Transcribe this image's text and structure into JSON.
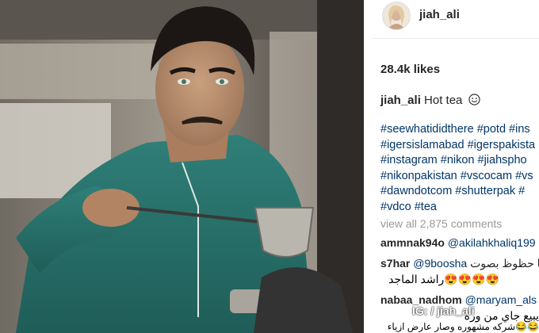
{
  "post": {
    "username": "jiah_ali",
    "likes": "28.4k likes",
    "caption_user": "jiah_ali",
    "caption_text": "Hot tea",
    "caption_emoji": "smiling-face-icon",
    "hashtag_lines": [
      "#seewhatididthere #potd #ins",
      "#igersislamabad #igerspakista",
      "#instagram #nikon #jiahspho",
      "#nikonpakistan #vscocam #vs",
      "#dawndotcom #shutterpak #",
      "#vdco #tea"
    ],
    "view_all_comments": "view all 2,875 comments",
    "comments": [
      {
        "user": "ammnak94o",
        "mention": "@akilahkhaliq199",
        "text": ""
      },
      {
        "user": "s7har",
        "mention": "@9boosha",
        "text": "يا حظوظ بصوت",
        "text2": "😍😍😍😍راشد الماجد"
      },
      {
        "user": "nabaa_nadhom",
        "mention": "@maryam_als",
        "text": "يبيع جاي من وره",
        "text2": "😂😂شركه مشهوره وصار عارض ازياء"
      }
    ]
  },
  "watermark": "IG: / jiah_ali",
  "colors": {
    "text": "#262626",
    "hashtag": "#003569",
    "muted": "#999999",
    "shirt": "#2e7d76"
  }
}
